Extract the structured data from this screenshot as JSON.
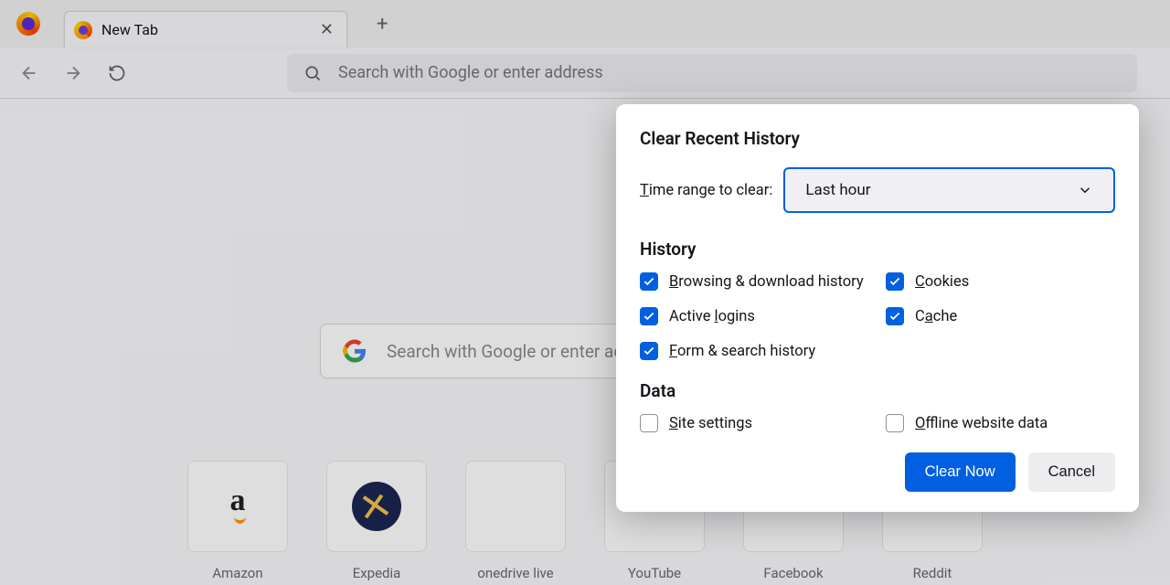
{
  "tab": {
    "title": "New Tab"
  },
  "addressbar": {
    "placeholder": "Search with Google or enter address"
  },
  "searchbox": {
    "placeholder": "Search with Google or enter address"
  },
  "shortcuts": [
    {
      "label": "Amazon"
    },
    {
      "label": "Expedia"
    },
    {
      "label": "onedrive live"
    },
    {
      "label": "YouTube"
    },
    {
      "label": "Facebook"
    },
    {
      "label": "Reddit"
    }
  ],
  "dialog": {
    "title": "Clear Recent History",
    "range_label_pre": "T",
    "range_label_post": "ime range to clear:",
    "range_value": "Last hour",
    "section_history": "History",
    "section_data": "Data",
    "checks": {
      "browsing": {
        "label_pre": "B",
        "label_post": "rowsing & download history",
        "checked": true
      },
      "cookies": {
        "label_pre": "C",
        "label_post": "ookies",
        "checked": true
      },
      "logins": {
        "label_pre": "Active ",
        "label_u": "l",
        "label_post": "ogins",
        "checked": true
      },
      "cache": {
        "label_pre": "C",
        "label_u": "a",
        "label_post": "che",
        "checked": true
      },
      "forms": {
        "label_pre": "F",
        "label_post": "orm & search history",
        "checked": true
      },
      "site": {
        "label_pre": "S",
        "label_post": "ite settings",
        "checked": false
      },
      "offline": {
        "label_pre": "O",
        "label_post": "ffline website data",
        "checked": false
      }
    },
    "clear_label": "Clear Now",
    "cancel_label": "Cancel"
  }
}
